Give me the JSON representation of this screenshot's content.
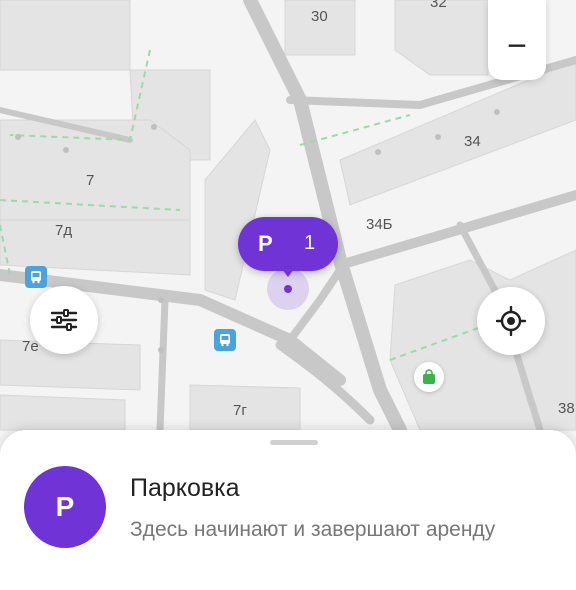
{
  "map": {
    "building_labels": [
      "30",
      "32",
      "34",
      "7",
      "7д",
      "34Б",
      "7е",
      "7г",
      "38"
    ]
  },
  "parking_pin": {
    "letter": "P",
    "count": "1"
  },
  "controls": {
    "zoom_out_label": "−",
    "filter_icon": "sliders-icon",
    "locate_icon": "crosshair-icon"
  },
  "bottom_sheet": {
    "avatar_letter": "P",
    "title": "Парковка",
    "subtitle": "Здесь начинают и завершают аренду"
  },
  "colors": {
    "accent": "#6f33d6",
    "map_background": "#f2f2f2",
    "building": "#e3e3e3",
    "road": "#c9c9c9",
    "path": "#9fd8a8",
    "bus_stop": "#4aa3df",
    "shop": "#3cb34a"
  }
}
